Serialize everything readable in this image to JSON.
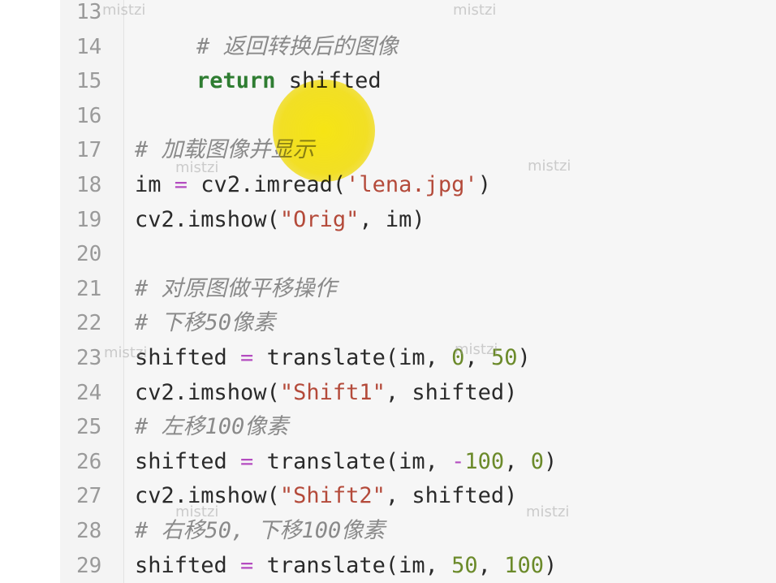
{
  "editor": {
    "lines": [
      {
        "number": "13",
        "indent": 1,
        "tokens": []
      },
      {
        "number": "14",
        "indent": 2,
        "tokens": [
          {
            "t": "# 返回转换后的图像",
            "k": "comment"
          }
        ]
      },
      {
        "number": "15",
        "indent": 2,
        "tokens": [
          {
            "t": "return",
            "k": "keyword"
          },
          {
            "t": " shifted",
            "k": "ident"
          }
        ]
      },
      {
        "number": "16",
        "indent": 0,
        "tokens": []
      },
      {
        "number": "17",
        "indent": 0,
        "tokens": [
          {
            "t": "# 加载图像并显示",
            "k": "comment"
          }
        ]
      },
      {
        "number": "18",
        "indent": 0,
        "tokens": [
          {
            "t": "im ",
            "k": "ident"
          },
          {
            "t": "=",
            "k": "operator"
          },
          {
            "t": " cv2.imread(",
            "k": "ident"
          },
          {
            "t": "'lena.jpg'",
            "k": "string"
          },
          {
            "t": ")",
            "k": "punct"
          }
        ]
      },
      {
        "number": "19",
        "indent": 0,
        "tokens": [
          {
            "t": "cv2.imshow(",
            "k": "ident"
          },
          {
            "t": "\"Orig\"",
            "k": "string"
          },
          {
            "t": ", im)",
            "k": "punct"
          }
        ]
      },
      {
        "number": "20",
        "indent": 0,
        "tokens": []
      },
      {
        "number": "21",
        "indent": 0,
        "tokens": [
          {
            "t": "# 对原图做平移操作",
            "k": "comment"
          }
        ]
      },
      {
        "number": "22",
        "indent": 0,
        "tokens": [
          {
            "t": "# 下移50像素",
            "k": "comment"
          }
        ]
      },
      {
        "number": "23",
        "indent": 0,
        "tokens": [
          {
            "t": "shifted ",
            "k": "ident"
          },
          {
            "t": "=",
            "k": "operator"
          },
          {
            "t": " translate(im, ",
            "k": "ident"
          },
          {
            "t": "0",
            "k": "number"
          },
          {
            "t": ", ",
            "k": "punct"
          },
          {
            "t": "50",
            "k": "number"
          },
          {
            "t": ")",
            "k": "punct"
          }
        ]
      },
      {
        "number": "24",
        "indent": 0,
        "tokens": [
          {
            "t": "cv2.imshow(",
            "k": "ident"
          },
          {
            "t": "\"Shift1\"",
            "k": "string"
          },
          {
            "t": ", shifted)",
            "k": "punct"
          }
        ]
      },
      {
        "number": "25",
        "indent": 0,
        "tokens": [
          {
            "t": "# 左移100像素",
            "k": "comment"
          }
        ]
      },
      {
        "number": "26",
        "indent": 0,
        "tokens": [
          {
            "t": "shifted ",
            "k": "ident"
          },
          {
            "t": "=",
            "k": "operator"
          },
          {
            "t": " translate(im, ",
            "k": "ident"
          },
          {
            "t": "-",
            "k": "operator"
          },
          {
            "t": "100",
            "k": "number"
          },
          {
            "t": ", ",
            "k": "punct"
          },
          {
            "t": "0",
            "k": "number"
          },
          {
            "t": ")",
            "k": "punct"
          }
        ]
      },
      {
        "number": "27",
        "indent": 0,
        "tokens": [
          {
            "t": "cv2.imshow(",
            "k": "ident"
          },
          {
            "t": "\"Shift2\"",
            "k": "string"
          },
          {
            "t": ", shifted)",
            "k": "punct"
          }
        ]
      },
      {
        "number": "28",
        "indent": 0,
        "tokens": [
          {
            "t": "# 右移50, 下移100像素",
            "k": "comment"
          }
        ]
      },
      {
        "number": "29",
        "indent": 0,
        "tokens": [
          {
            "t": "shifted ",
            "k": "ident"
          },
          {
            "t": "=",
            "k": "operator"
          },
          {
            "t": " translate(im, ",
            "k": "ident"
          },
          {
            "t": "50",
            "k": "number"
          },
          {
            "t": ", ",
            "k": "punct"
          },
          {
            "t": "100",
            "k": "number"
          },
          {
            "t": ")",
            "k": "punct"
          }
        ]
      }
    ]
  },
  "watermark": {
    "text": "mistzi"
  },
  "colors": {
    "comment": "#8a8a8a",
    "keyword": "#2f7d32",
    "operator": "#b44cc0",
    "string": "#b44a3a",
    "number": "#6b8a2a",
    "highlight": "#ffec00"
  }
}
